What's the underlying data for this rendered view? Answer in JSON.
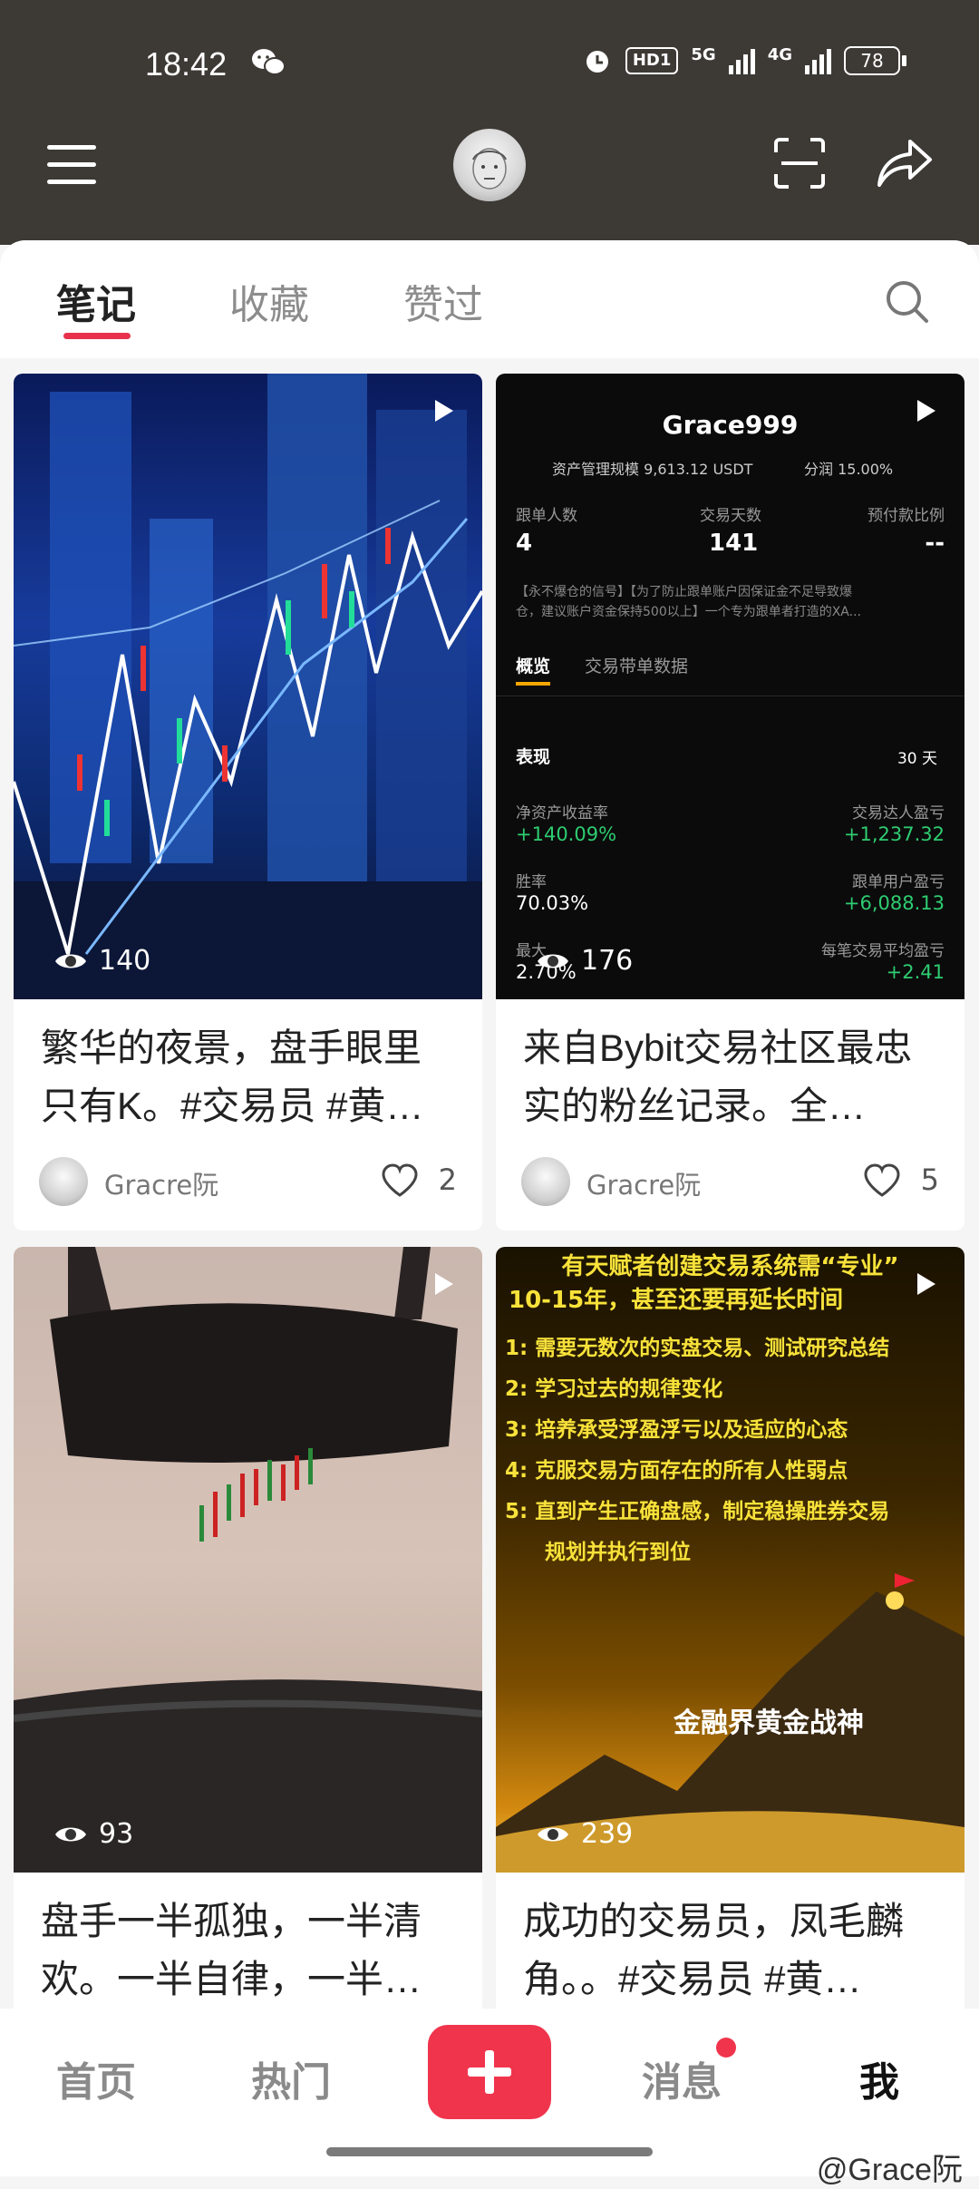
{
  "status_bar": {
    "time": "18:42",
    "hd_label": "HD1",
    "net1": "5G",
    "net2": "4G",
    "battery": "78"
  },
  "tabs": [
    "笔记",
    "收藏",
    "赞过"
  ],
  "cards": [
    {
      "views": "140",
      "caption": "繁华的夜景，盘手眼里只有K。#交易员 #黄…",
      "author": "Gracre阮",
      "likes": "2"
    },
    {
      "views": "176",
      "caption": "来自Bybit交易社区最忠实的粉丝记录。全…",
      "author": "Gracre阮",
      "likes": "5",
      "dashboard": {
        "name": "Grace999",
        "aum_label": "资产管理规模",
        "aum_value": "9,613.12 USDT",
        "share_label": "分润",
        "share_value": "15.00%",
        "followers_label": "跟单人数",
        "followers_value": "4",
        "days_label": "交易天数",
        "days_value": "141",
        "prepay_label": "预付款比例",
        "prepay_value": "--",
        "desc_line1": "【永不爆仓的信号】【为了防止跟单账户因保证金不足导致爆",
        "desc_line2": "仓，建议账户资金保持500以上】一个专为跟单者打造的XA...",
        "tab_overview": "概览",
        "tab_data": "交易带单数据",
        "perf_label": "表现",
        "period": "30 天",
        "roi_label": "净资产收益率",
        "roi_value": "+140.09%",
        "trader_pnl_label": "交易达人盈亏",
        "trader_pnl_value": "+1,237.32",
        "winrate_label": "胜率",
        "winrate_value": "70.03%",
        "follower_pnl_label": "跟单用户盈亏",
        "follower_pnl_value": "+6,088.13",
        "maxdd_label": "最大",
        "maxdd_value": "2.70%",
        "avg_pnl_label": "每笔交易平均盈亏",
        "avg_pnl_value": "+2.41"
      }
    },
    {
      "views": "93",
      "caption": "盘手一半孤独，一半清欢。一半自律，一半…"
    },
    {
      "views": "239",
      "caption": "成功的交易员，凤毛麟角。。#交易员 #黄…",
      "poster": {
        "title1": "有天赋者创建交易系统需“专业”",
        "title2": "10-15年，甚至还要再延长时间",
        "items": [
          "1: 需要无数次的实盘交易、测试研究总结",
          "2: 学习过去的规律变化",
          "3: 培养承受浮盈浮亏以及适应的心态",
          "4: 克服交易方面存在的所有人性弱点",
          "5: 直到产生正确盘感，制定稳操胜券交易",
          "规划并执行到位"
        ],
        "tagline": "金融界黄金战神"
      }
    }
  ],
  "bottom_nav": {
    "home": "首页",
    "hot": "热门",
    "messages": "消息",
    "me": "我"
  },
  "watermark": "@Grace阮",
  "colors": {
    "accent": "#f0344c",
    "header_bg": "#3d3935",
    "gain_green": "#2ecc71"
  }
}
